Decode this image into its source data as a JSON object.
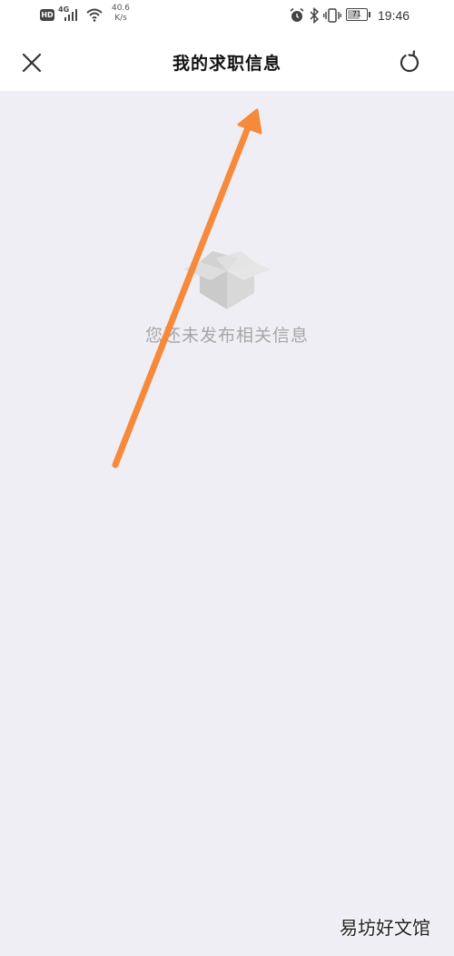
{
  "status_bar": {
    "hd_label": "HD",
    "network_label": "4G",
    "speed_value": "40.6",
    "speed_unit": "K/s",
    "battery_level": "71",
    "time": "19:46"
  },
  "nav": {
    "title": "我的求职信息",
    "close_icon": "close-icon",
    "refresh_icon": "refresh-icon"
  },
  "empty_state": {
    "icon": "empty-box-icon",
    "message": "您还未发布相关信息"
  },
  "annotation": {
    "type": "arrow",
    "color": "#f6893a"
  },
  "watermark": {
    "text": "易坊好文馆"
  },
  "colors": {
    "background": "#efeef4",
    "header": "#ffffff",
    "empty_text": "#a6a6a6"
  }
}
